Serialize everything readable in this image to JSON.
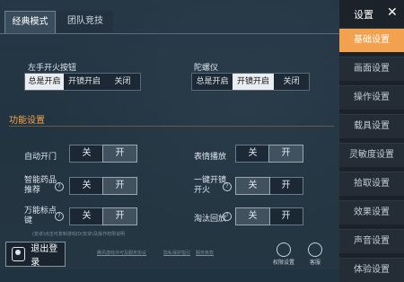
{
  "tabs": [
    "经典模式",
    "团队竞技"
  ],
  "left_fire": {
    "label": "左手开火按钮",
    "options": [
      "总是开启",
      "开镜开启",
      "关闭"
    ],
    "selected": 0
  },
  "gyro": {
    "label": "陀螺仪",
    "options": [
      "总是开启",
      "开镜开启",
      "关闭"
    ],
    "selected": 1
  },
  "section_title": "功能设置",
  "toggles": [
    {
      "label": "自动开门",
      "off": "关",
      "on": "开",
      "value": "开"
    },
    {
      "label": "表情播放",
      "off": "关",
      "on": "开",
      "value": "开"
    },
    {
      "label": "智能药品推荐",
      "off": "关",
      "on": "开",
      "value": "开"
    },
    {
      "label": "一键开镜开火",
      "off": "关",
      "on": "开",
      "value": "关"
    },
    {
      "label": "万能标点键",
      "off": "关",
      "on": "开",
      "value": "开"
    },
    {
      "label": "淘汰回放",
      "off": "关",
      "on": "开",
      "value": "关"
    }
  ],
  "footer": {
    "note_left": "(安卓)点击可复制游戏ID(安卓)及操作权限说明",
    "link1": "腾讯游戏许可及服务协议",
    "link2": "隐私保护指引",
    "link3": "服务条款"
  },
  "logout_label": "退出登录",
  "bottom_icons": [
    {
      "icon": "privacy-settings-icon",
      "label": "权限设置"
    },
    {
      "icon": "customer-service-icon",
      "label": "客服"
    }
  ],
  "sidebar": {
    "title": "设置",
    "items": [
      "基础设置",
      "画面设置",
      "操作设置",
      "载具设置",
      "灵敏度设置",
      "拾取设置",
      "效果设置",
      "声音设置",
      "体验设置"
    ],
    "active": 0
  },
  "colors": {
    "accent": "#f2a14e",
    "section": "#f0a34a"
  }
}
